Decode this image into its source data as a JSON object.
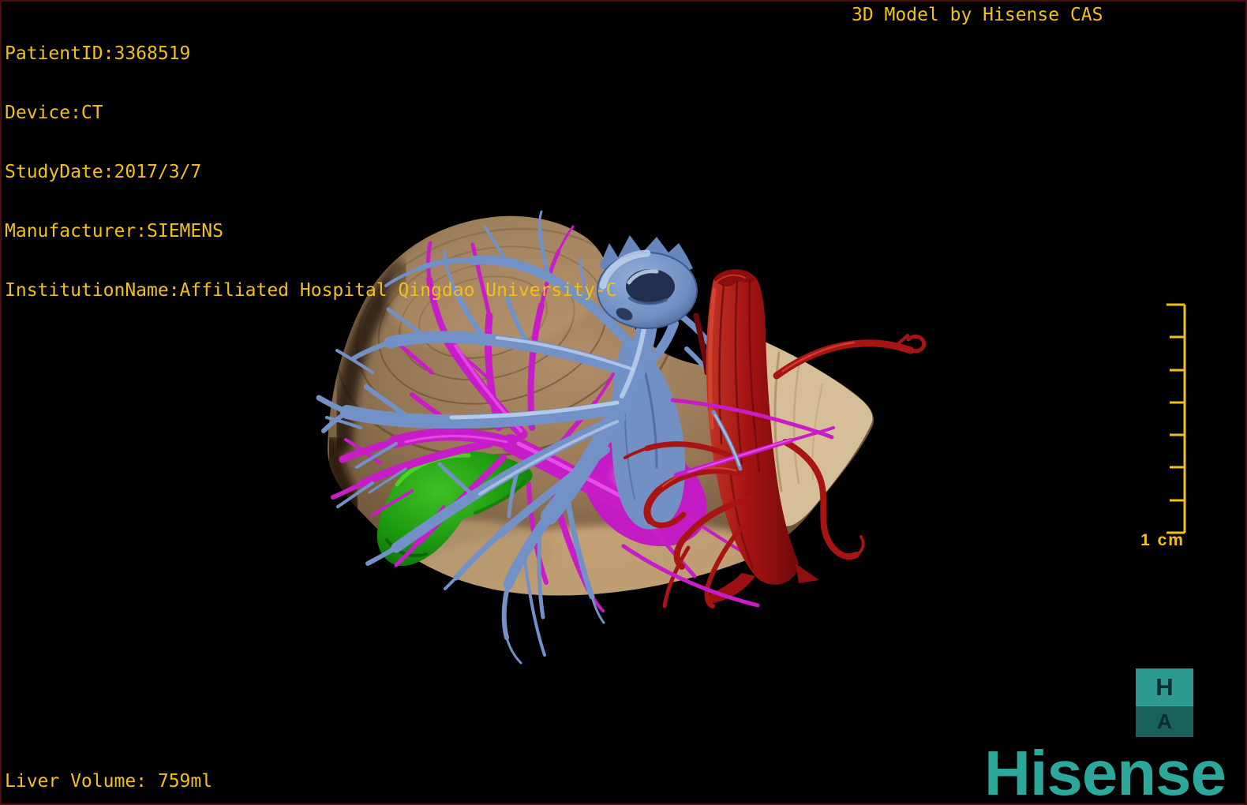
{
  "header": {
    "patient_lines": [
      "PatientID:3368519",
      "Device:CT",
      "StudyDate:2017/3/7",
      "Manufacturer:SIEMENS",
      "InstitutionName:Affiliated Hospital Qingdao University-C"
    ],
    "watermark": "3D Model by Hisense CAS"
  },
  "footer": {
    "liver_volume": "Liver Volume: 759ml"
  },
  "scale_bar": {
    "label": "1 cm",
    "tick_count": 8,
    "color": "#F2C01A"
  },
  "branding": {
    "logo_text": "Hisense",
    "logo_color": "#2BA89B",
    "badge_top_letter": "H",
    "badge_bottom_letter": "A",
    "badge_top_bg": "#2D9A92",
    "badge_bottom_bg": "#186059"
  },
  "colors": {
    "overlay_text": "#F2C01A",
    "background": "#000000",
    "frame_border": "#4E0D10"
  },
  "model": {
    "structures": [
      {
        "name": "liver-surface",
        "color": "#A98A68"
      },
      {
        "name": "hepatic-vein",
        "color": "#7291C6"
      },
      {
        "name": "portal-vein",
        "color": "#C81CC8"
      },
      {
        "name": "artery-ivc",
        "color": "#A81414"
      },
      {
        "name": "gallbladder",
        "color": "#1F9A12"
      }
    ]
  }
}
